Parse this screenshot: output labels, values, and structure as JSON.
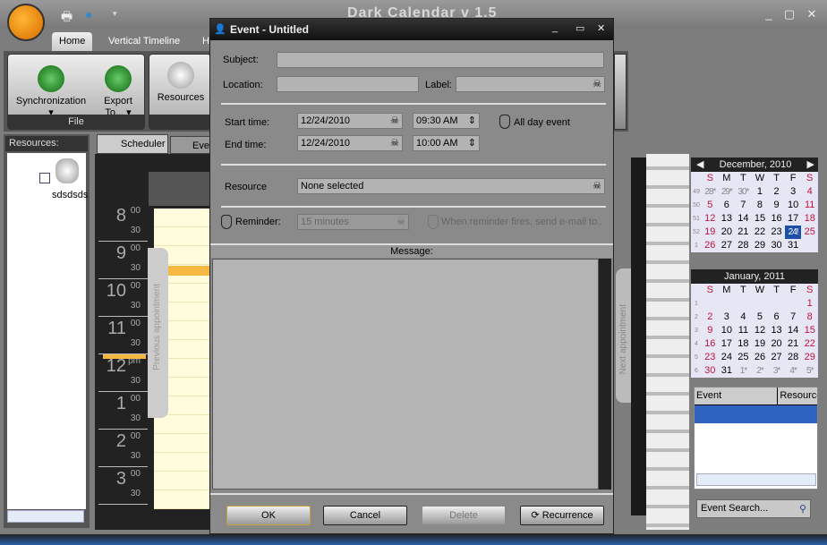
{
  "app": {
    "title": "Dark Calendar v 1.5"
  },
  "ribbon": {
    "tabs": [
      "Home",
      "Vertical Timeline",
      "H"
    ],
    "groups": [
      {
        "label": "File",
        "buttons": [
          "Synchronization",
          "Export To..."
        ]
      },
      {
        "label": "",
        "buttons": [
          "Resources"
        ]
      }
    ]
  },
  "resources": {
    "header": "Resources:",
    "items": [
      {
        "name": "sdsdsds",
        "checked": false
      }
    ]
  },
  "scheduler": {
    "tabs": [
      "Scheduler",
      "Eve"
    ],
    "hours": [
      {
        "h": "8",
        "m": "00"
      },
      {
        "h": "9",
        "m": "00"
      },
      {
        "h": "10",
        "m": "00"
      },
      {
        "h": "11",
        "m": "00"
      },
      {
        "h": "12",
        "m": "pm"
      },
      {
        "h": "1",
        "m": "00"
      },
      {
        "h": "2",
        "m": "00"
      },
      {
        "h": "3",
        "m": "00"
      }
    ],
    "half": "30",
    "prev": "Previous appointment",
    "next": "Next appointment"
  },
  "dialog": {
    "title": "Event - Untitled",
    "subject_label": "Subject:",
    "subject": "",
    "location_label": "Location:",
    "location": "",
    "label_label": "Label:",
    "label": "",
    "start_label": "Start time:",
    "start_date": "12/24/2010",
    "start_time": "09:30 AM",
    "end_label": "End time:",
    "end_date": "12/24/2010",
    "end_time": "10:00 AM",
    "allday": "All day event",
    "resource_label": "Resource",
    "resource": "None selected",
    "reminder_label": "Reminder:",
    "reminder": "15 minutes",
    "email": "When reminder fires, send e-mail to..",
    "message_label": "Message:",
    "ok": "OK",
    "cancel": "Cancel",
    "delete": "Delete",
    "recurrence": "Recurrence"
  },
  "calendars": [
    {
      "title": "December, 2010",
      "days": [
        "S",
        "M",
        "T",
        "W",
        "T",
        "F",
        "S"
      ],
      "weeks": [
        [
          "49",
          "28*",
          "29*",
          "30*",
          "1",
          "2",
          "3",
          "4"
        ],
        [
          "50",
          "5",
          "6",
          "7",
          "8",
          "9",
          "10",
          "11"
        ],
        [
          "51",
          "12",
          "13",
          "14",
          "15",
          "16",
          "17",
          "18"
        ],
        [
          "52",
          "19",
          "20",
          "21",
          "22",
          "23",
          "24!",
          "25"
        ],
        [
          "1",
          "26",
          "27",
          "28",
          "29",
          "30",
          "31",
          ""
        ]
      ]
    },
    {
      "title": "January, 2011",
      "days": [
        "S",
        "M",
        "T",
        "W",
        "T",
        "F",
        "S"
      ],
      "weeks": [
        [
          "1",
          "",
          "",
          "",
          "",
          "",
          "",
          "1"
        ],
        [
          "2",
          "2",
          "3",
          "4",
          "5",
          "6",
          "7",
          "8"
        ],
        [
          "3",
          "9",
          "10",
          "11",
          "12",
          "13",
          "14",
          "15"
        ],
        [
          "4",
          "16",
          "17",
          "18",
          "19",
          "20",
          "21",
          "22"
        ],
        [
          "5",
          "23",
          "24",
          "25",
          "26",
          "27",
          "28",
          "29"
        ],
        [
          "6",
          "30",
          "31",
          "1*",
          "2*",
          "3*",
          "4*",
          "5*"
        ]
      ]
    }
  ],
  "events_grid": {
    "columns": [
      "Event",
      "Resource"
    ]
  },
  "search": {
    "placeholder": "Event Search..."
  },
  "colors": {
    "weekend": "#c0143c",
    "selected": "#1c4fa8",
    "accent": "#f5b942"
  }
}
